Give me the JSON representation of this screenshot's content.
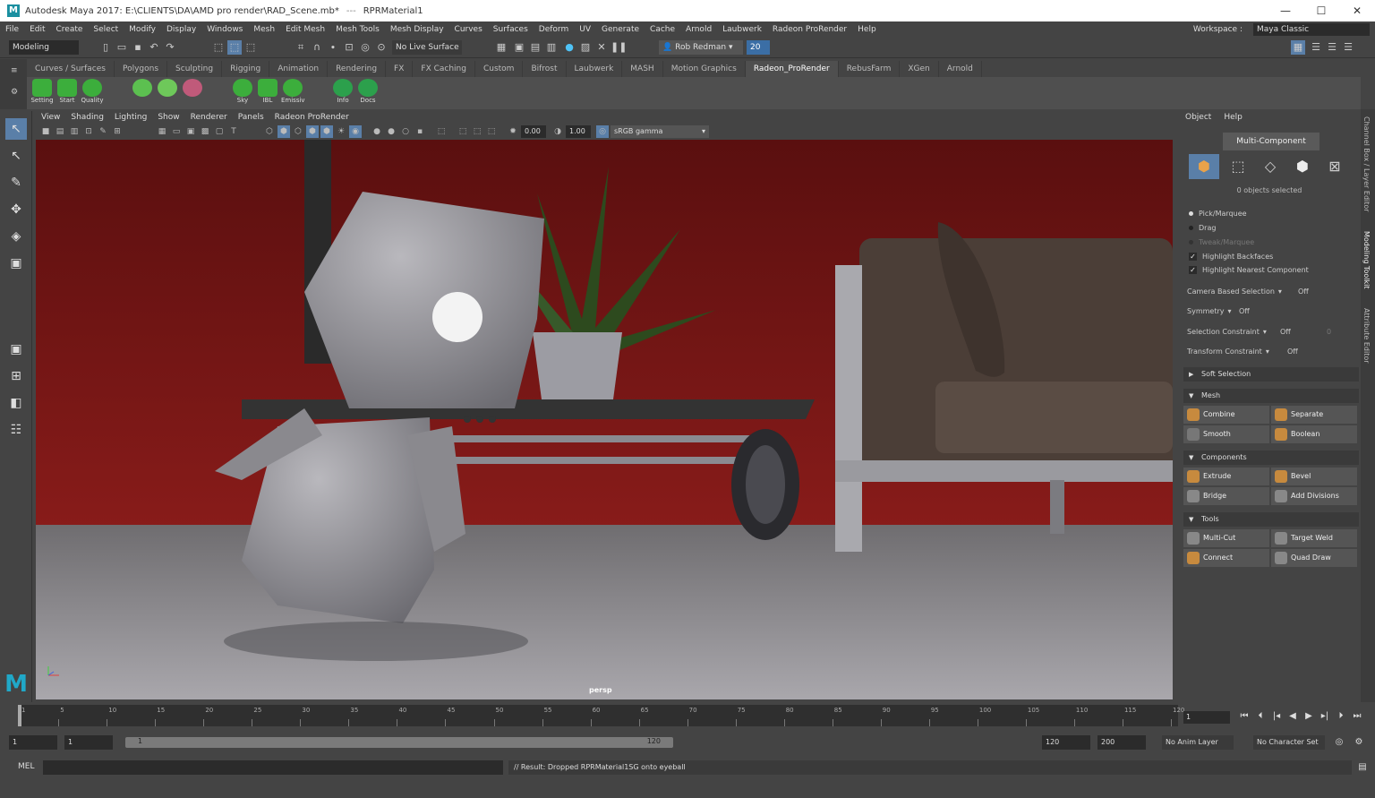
{
  "window": {
    "title": "Autodesk Maya 2017: E:\\CLIENTS\\DA\\AMD pro render\\RAD_Scene.mb*",
    "separator": "---",
    "subtitle": "RPRMaterial1",
    "min": "—",
    "max": "☐",
    "close": "✕"
  },
  "menus": [
    "File",
    "Edit",
    "Create",
    "Select",
    "Modify",
    "Display",
    "Windows",
    "Mesh",
    "Edit Mesh",
    "Mesh Tools",
    "Mesh Display",
    "Curves",
    "Surfaces",
    "Deform",
    "UV",
    "Generate",
    "Cache",
    "Arnold",
    "Laubwerk",
    "Radeon ProRender",
    "Help"
  ],
  "workspace": {
    "label": "Workspace :",
    "value": "Maya Classic"
  },
  "statusline": {
    "mode": "Modeling",
    "live_surface": "No Live Surface",
    "user": "Rob Redman",
    "notifications": "20"
  },
  "shelf": {
    "tabs": [
      "Curves / Surfaces",
      "Polygons",
      "Sculpting",
      "Rigging",
      "Animation",
      "Rendering",
      "FX",
      "FX Caching",
      "Custom",
      "Bifrost",
      "Laubwerk",
      "MASH",
      "Motion Graphics",
      "Radeon_ProRender",
      "RebusFarm",
      "XGen",
      "Arnold"
    ],
    "active_tab": "Radeon_ProRender",
    "icons": [
      {
        "label": "Setting",
        "color": "#3cae3c"
      },
      {
        "label": "Start",
        "color": "#3cae3c"
      },
      {
        "label": "Quality",
        "color": "#3cae3c"
      },
      {
        "label": "",
        "color": "#5cc050"
      },
      {
        "label": "",
        "color": "#6ec85a"
      },
      {
        "label": "",
        "color": "#c05a7a"
      },
      {
        "label": "Sky",
        "color": "#3cae3c"
      },
      {
        "label": "IBL",
        "color": "#3cae3c"
      },
      {
        "label": "Emissiv",
        "color": "#3cae3c"
      },
      {
        "label": "Info",
        "color": "#2ca04c"
      },
      {
        "label": "Docs",
        "color": "#2ca04c"
      }
    ]
  },
  "panel_menu": [
    "View",
    "Shading",
    "Lighting",
    "Show",
    "Renderer",
    "Panels",
    "Radeon ProRender"
  ],
  "panel_tools": {
    "exposure": "0.00",
    "gamma": "1.00",
    "colorspace": "sRGB gamma"
  },
  "viewport": {
    "camera": "persp"
  },
  "modeling_toolkit": {
    "menu": [
      "Object",
      "Help"
    ],
    "mode": "Multi-Component",
    "selected_text": "0 objects selected",
    "pick": [
      "Pick/Marquee",
      "Drag",
      "Tweak/Marquee"
    ],
    "highlight_backfaces": "Highlight Backfaces",
    "highlight_nearest": "Highlight Nearest Component",
    "camera_based": {
      "label": "Camera Based Selection",
      "value": "Off"
    },
    "symmetry": {
      "label": "Symmetry",
      "value": "Off"
    },
    "selection_constraint": {
      "label": "Selection Constraint",
      "value": "Off",
      "extra": "0"
    },
    "transform_constraint": {
      "label": "Transform Constraint",
      "value": "Off"
    },
    "soft_selection": "Soft Selection",
    "mesh": {
      "title": "Mesh",
      "buttons": [
        "Combine",
        "Separate",
        "Smooth",
        "Boolean"
      ]
    },
    "components": {
      "title": "Components",
      "buttons": [
        "Extrude",
        "Bevel",
        "Bridge",
        "Add Divisions"
      ]
    },
    "tools": {
      "title": "Tools",
      "buttons": [
        "Multi-Cut",
        "Target Weld",
        "Connect",
        "Quad Draw"
      ]
    }
  },
  "side_tabs": [
    "Channel Box / Layer Editor",
    "Modeling Toolkit",
    "Attribute Editor"
  ],
  "timeline": {
    "ticks": [
      "5",
      "10",
      "15",
      "20",
      "25",
      "30",
      "35",
      "40",
      "45",
      "50",
      "55",
      "60",
      "65",
      "70",
      "75",
      "80",
      "85",
      "90",
      "95",
      "100",
      "105",
      "110",
      "115",
      "120"
    ],
    "start_tick": "1",
    "current_frame": "1"
  },
  "range": {
    "start": "1",
    "range_start": "1",
    "bar_start": "1",
    "bar_end": "120",
    "range_end": "120",
    "end": "200",
    "anim_layer": "No Anim Layer",
    "character_set": "No Character Set"
  },
  "command": {
    "lang": "MEL",
    "result": "// Result: Dropped RPRMaterial1SG onto eyeball"
  }
}
